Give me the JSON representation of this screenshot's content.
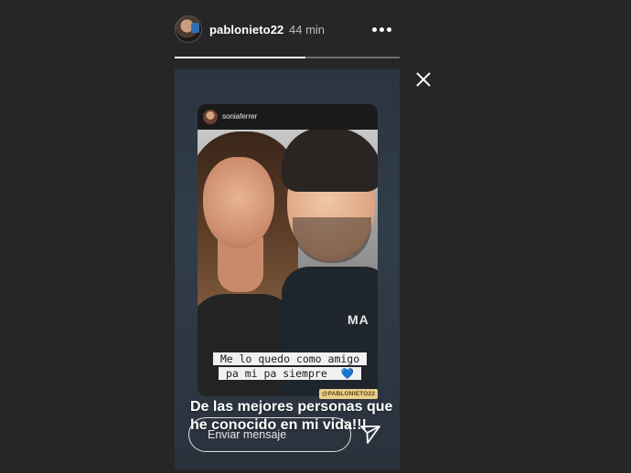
{
  "header": {
    "username": "pablonieto22",
    "time": "44 min"
  },
  "progress": {
    "fraction": 0.58
  },
  "story": {
    "repost_username": "soniaferrer",
    "photo_text": "MA",
    "quote_line1": "Me lo quedo como amigo",
    "quote_line2": "pa mi pa siempre",
    "quote_emoji": "💙",
    "mention": "@PABLONIETO22",
    "caption": "De las mejores personas que he conocido en mi vida!!!"
  },
  "reply": {
    "placeholder": "Enviar mensaje"
  },
  "icons": {
    "more": "more-horizontal-icon",
    "close": "close-icon",
    "send": "paper-plane-icon"
  }
}
